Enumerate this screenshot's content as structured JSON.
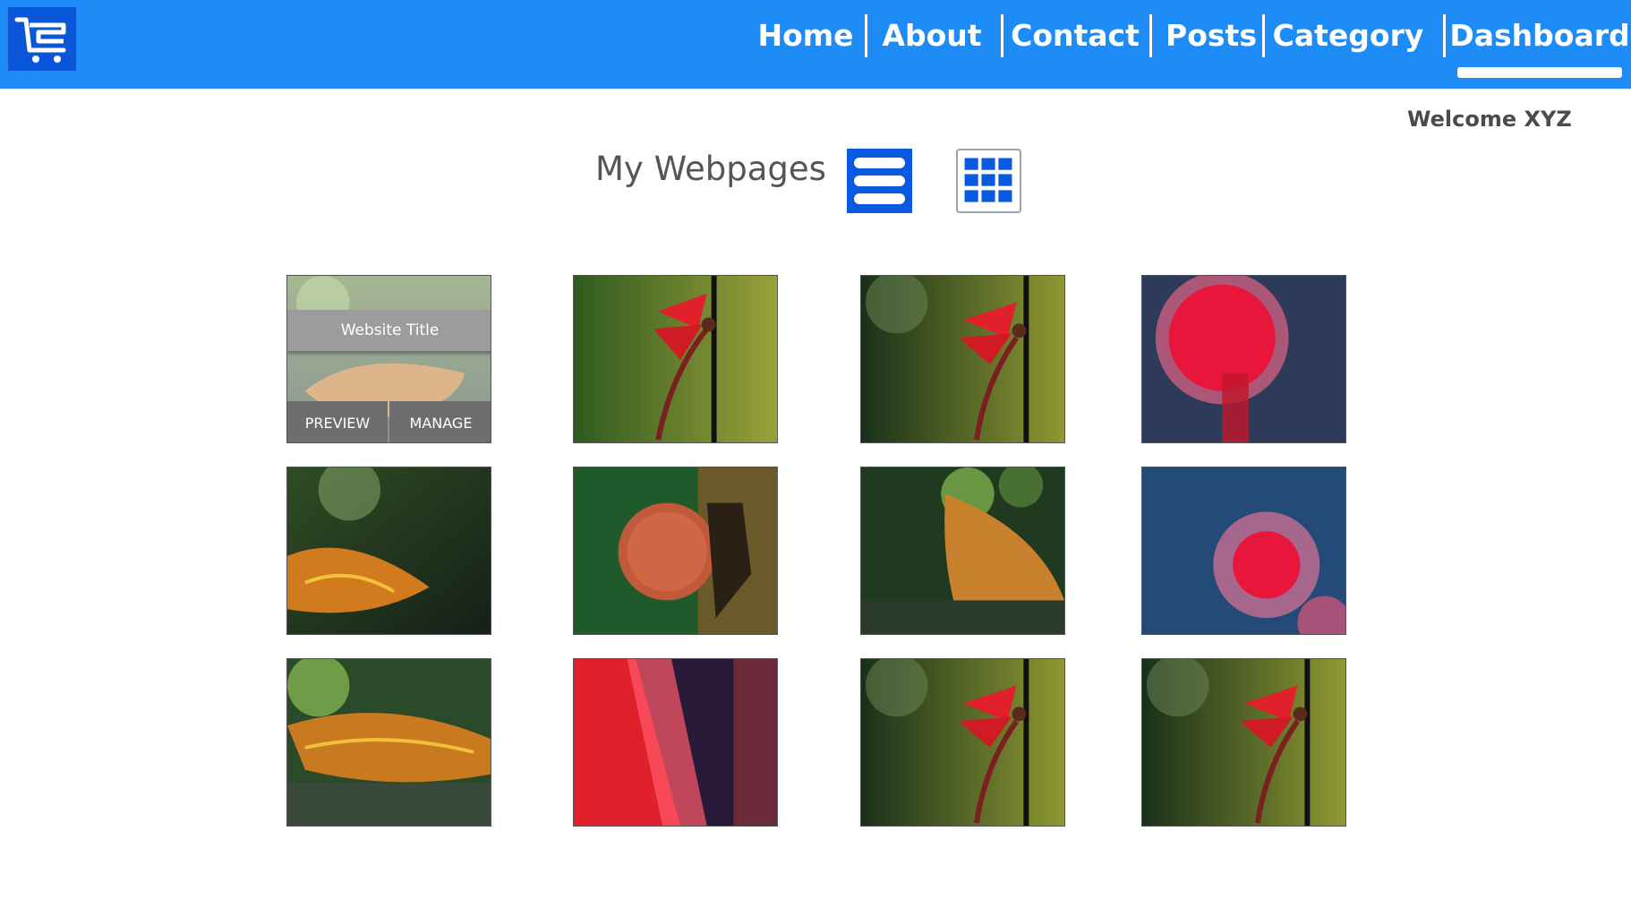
{
  "nav": {
    "logo_icon": "shopping-cart-icon",
    "items": [
      {
        "label": "Home"
      },
      {
        "label": "About"
      },
      {
        "label": "Contact"
      },
      {
        "label": "Posts"
      },
      {
        "label": "Category"
      },
      {
        "label": "Dashboard",
        "active": true
      }
    ]
  },
  "welcome": "Welcome XYZ",
  "page_title": "My Webpages",
  "view_toggle": {
    "list_icon": "list-view-icon",
    "grid_icon": "grid-view-icon",
    "active": "list"
  },
  "tiles": [
    {
      "image": "leaf",
      "hover": true
    },
    {
      "image": "dragonfly"
    },
    {
      "image": "dragonfly"
    },
    {
      "image": "red-flower"
    },
    {
      "image": "leaf"
    },
    {
      "image": "fly-eye"
    },
    {
      "image": "leaf"
    },
    {
      "image": "pink-flower"
    },
    {
      "image": "leaf"
    },
    {
      "image": "red-blur"
    },
    {
      "image": "dragonfly"
    },
    {
      "image": "dragonfly"
    }
  ],
  "hover_card": {
    "title": "Website Title",
    "preview_label": "PREVIEW",
    "manage_label": "MANAGE"
  },
  "colors": {
    "nav_bg": "#1e8cf7",
    "logo_bg": "#0a56d8",
    "toggle_active": "#0a5ae0"
  }
}
